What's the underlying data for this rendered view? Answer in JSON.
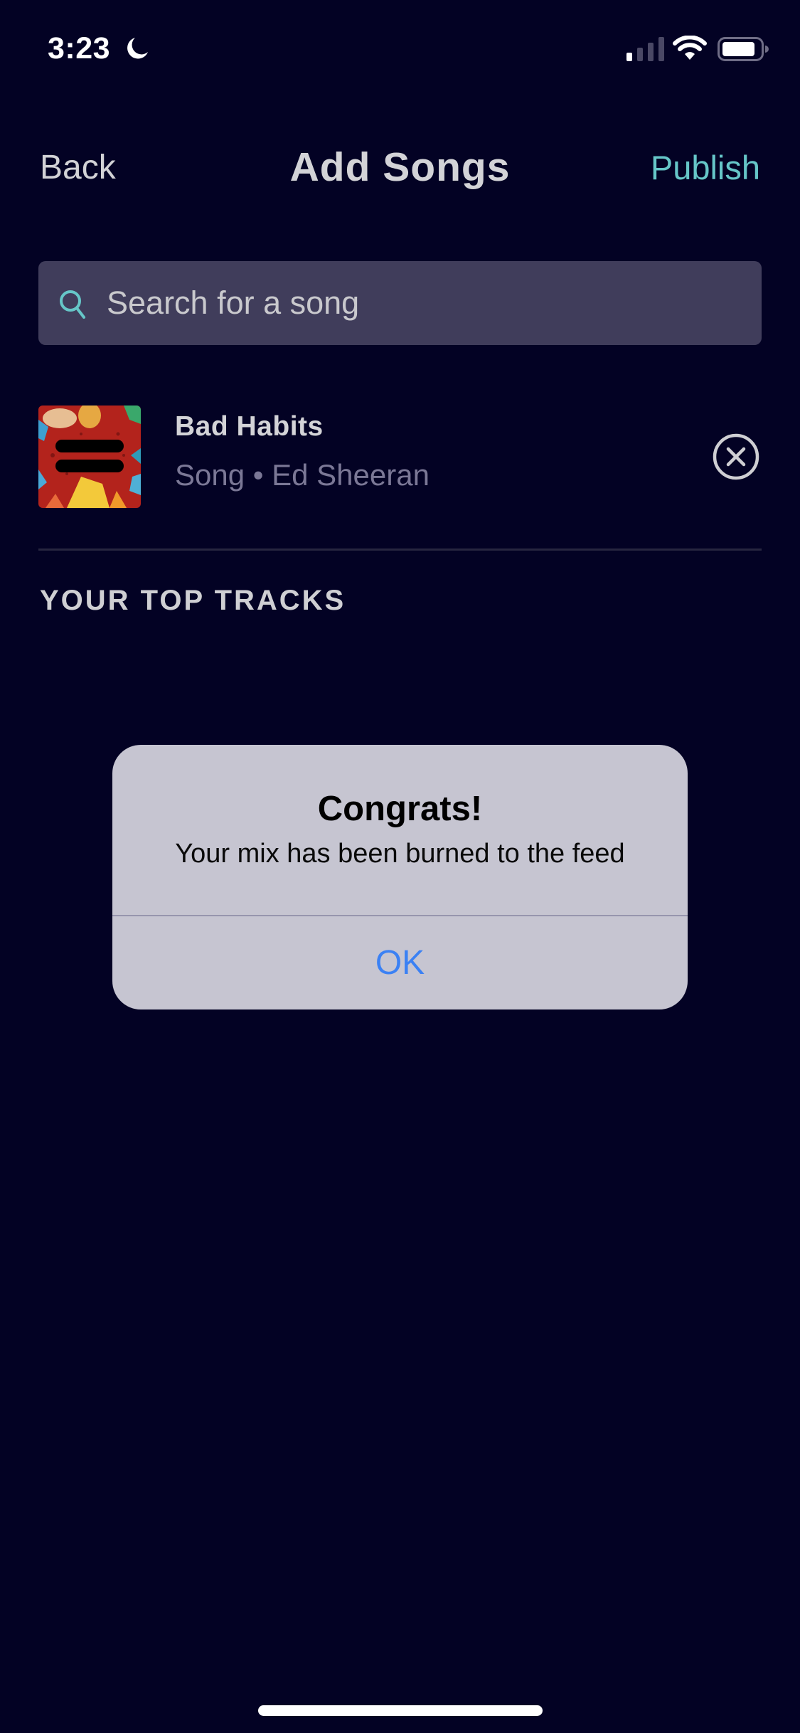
{
  "status_bar": {
    "time": "3:23",
    "focus_icon": "moon-icon",
    "signal_icon": "cellular-signal-icon",
    "wifi_icon": "wifi-icon",
    "battery_icon": "battery-icon"
  },
  "header": {
    "back_label": "Back",
    "title": "Add Songs",
    "publish_label": "Publish"
  },
  "search": {
    "placeholder": "Search for a song",
    "value": "",
    "icon": "search-icon"
  },
  "selected_songs": [
    {
      "title": "Bad Habits",
      "subtitle": "Song • Ed Sheeran",
      "type": "Song",
      "artist": "Ed Sheeran",
      "remove_icon": "close-circle-icon"
    }
  ],
  "sections": {
    "top_tracks_heading": "YOUR TOP TRACKS"
  },
  "alert": {
    "title": "Congrats!",
    "message": "Your mix has been burned to the feed",
    "ok_label": "OK"
  },
  "colors": {
    "background": "#030224",
    "accent": "#66c6c8",
    "search_field": "#403d5b",
    "alert_background": "#c6c5d1",
    "alert_button": "#3b81f4",
    "secondary_text": "#7b7896"
  }
}
